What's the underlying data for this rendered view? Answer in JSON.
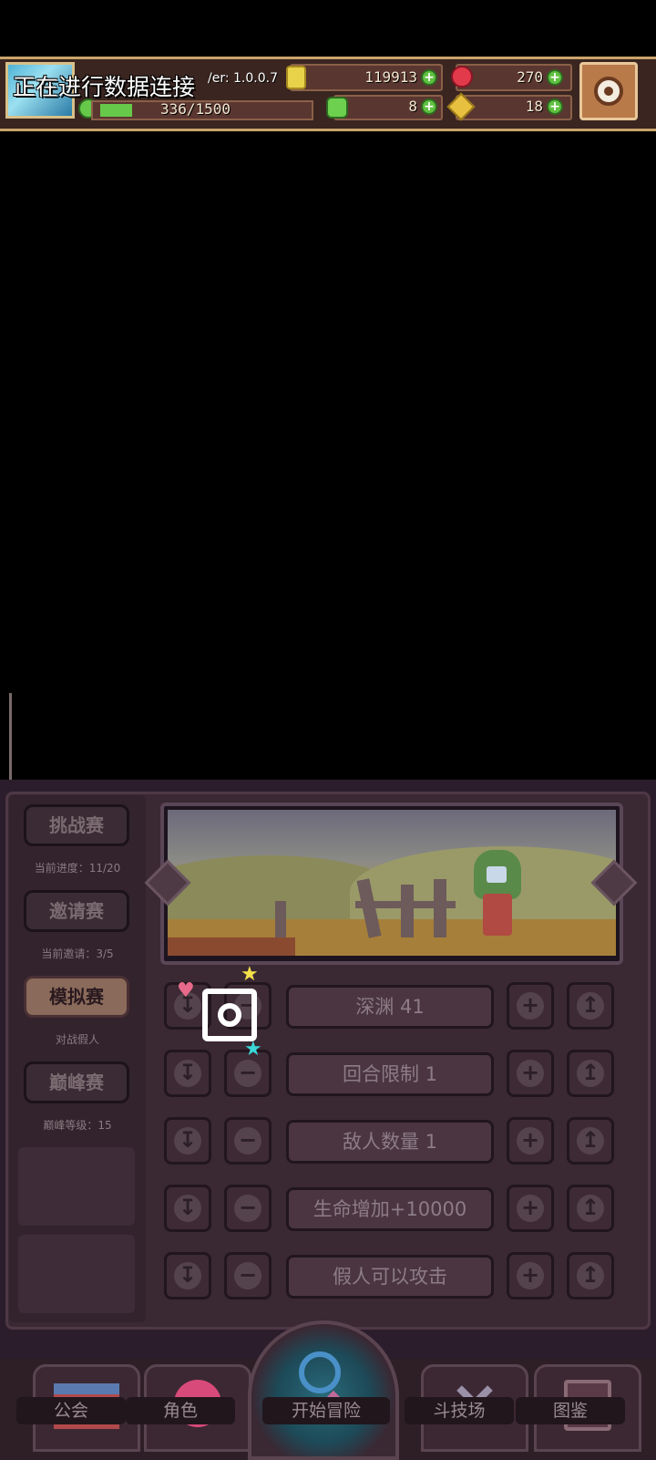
{
  "status_bar": {
    "connecting_text": "正在进行数据连接",
    "version": "/er: 1.0.0.7",
    "gold": "119913",
    "gems": "270",
    "energy": "336/1500",
    "energy_fill_fraction": 0.15,
    "clover": "8",
    "keys": "18"
  },
  "modes": [
    {
      "label": "挑战赛",
      "sub": "当前进度：11/20",
      "active": false
    },
    {
      "label": "邀请赛",
      "sub": "当前邀请：3/5",
      "active": false
    },
    {
      "label": "模拟赛",
      "sub": "对战假人",
      "active": true
    },
    {
      "label": "巅峰赛",
      "sub": "巅峰等级：15",
      "active": false
    }
  ],
  "settings_rows": [
    {
      "label": "深渊 41"
    },
    {
      "label": "回合限制 1"
    },
    {
      "label": "敌人数量 1"
    },
    {
      "label": "生命增加+10000"
    },
    {
      "label": "假人可以攻击"
    }
  ],
  "bottom_nav": {
    "guild": "公会",
    "character": "角色",
    "adventure": "开始冒险",
    "arena": "斗技场",
    "codex": "图鉴"
  },
  "colors": {
    "background": "#000000",
    "panel": "#2b1d2c",
    "accent_gold": "#c9a46a",
    "plus_green": "#5fc040"
  }
}
